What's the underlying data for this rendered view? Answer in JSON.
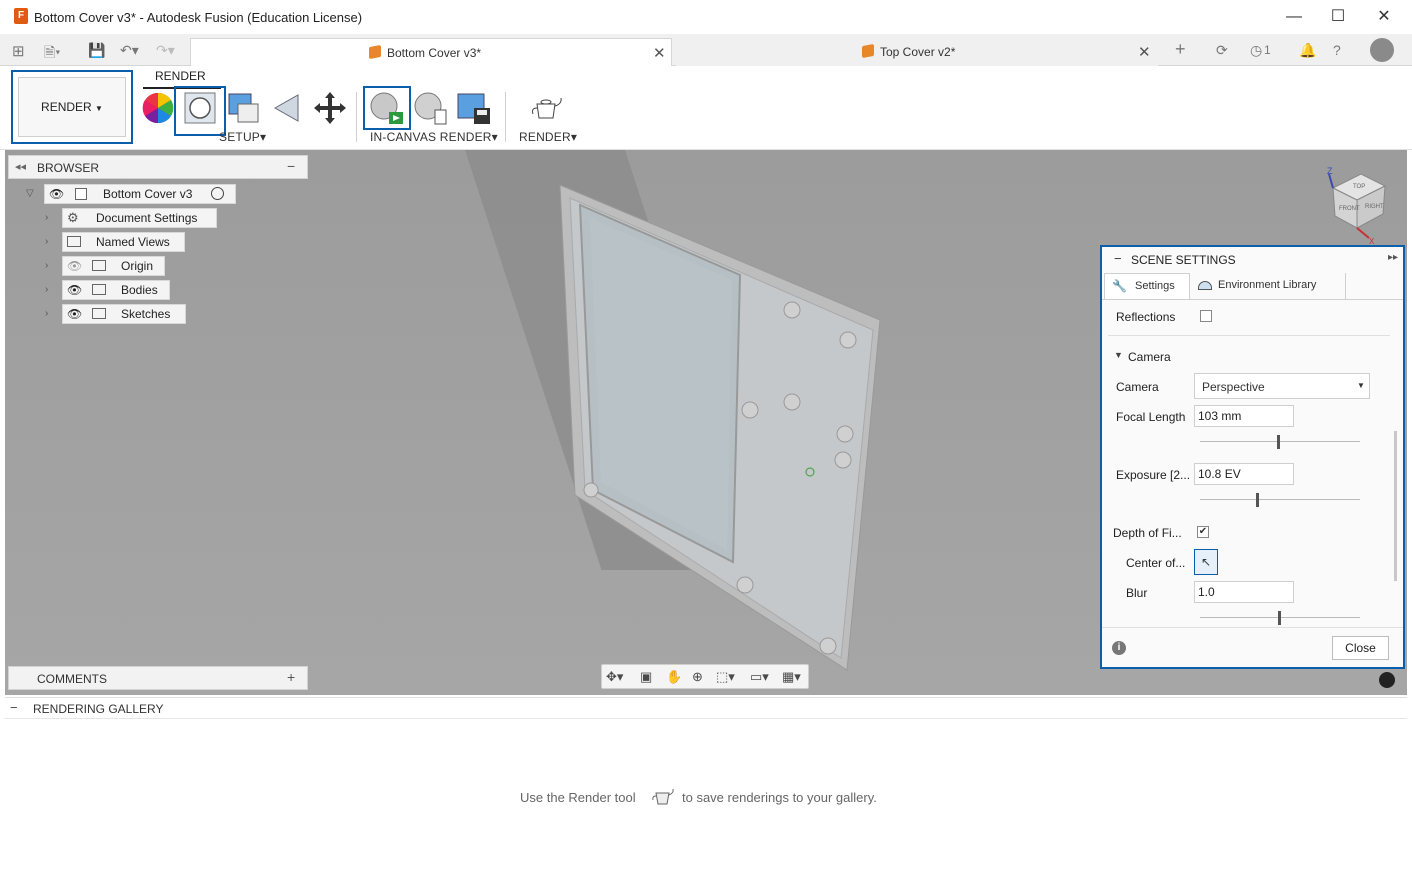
{
  "window": {
    "logo_letter": "F",
    "title": "Bottom Cover v3* - Autodesk Fusion (Education License)",
    "minimize": "—",
    "maximize": "☐",
    "close": "✕"
  },
  "tabs": [
    {
      "label": "Bottom Cover v3*",
      "close": "✕"
    },
    {
      "label": "Top Cover v2*",
      "close": "✕"
    }
  ],
  "tabbar": {
    "add": "+",
    "jobs_count": "1"
  },
  "toolbar": {
    "workspace": "RENDER",
    "workspace_caret": "▼",
    "tab_label": "RENDER",
    "groups": {
      "setup": "SETUP",
      "in_canvas": "IN-CANVAS RENDER",
      "render": "RENDER"
    },
    "caret": "▾"
  },
  "browser": {
    "title": "BROWSER",
    "collapse": "−",
    "root": "Bottom Cover v3",
    "items": [
      {
        "label": "Document Settings",
        "icon": "gear-icon"
      },
      {
        "label": "Named Views",
        "icon": "folder-icon"
      },
      {
        "label": "Origin",
        "icon": "folder-icon"
      },
      {
        "label": "Bodies",
        "icon": "folder-icon"
      },
      {
        "label": "Sketches",
        "icon": "folder-icon"
      }
    ]
  },
  "comments": {
    "title": "COMMENTS",
    "add": "+"
  },
  "scene_settings": {
    "title": "SCENE SETTINGS",
    "tabs": [
      "Settings",
      "Environment Library"
    ],
    "reflections_label": "Reflections",
    "reflections_checked": false,
    "camera_section": "Camera",
    "camera_label": "Camera",
    "camera_value": "Perspective",
    "focal_label": "Focal Length",
    "focal_value": "103 mm",
    "focal_slider": 0.48,
    "exposure_label": "Exposure [2...",
    "exposure_value": "10.8 EV",
    "exposure_slider": 0.35,
    "dof_label": "Depth of Fi...",
    "dof_checked": true,
    "center_label": "Center of...",
    "blur_label": "Blur",
    "blur_value": "1.0",
    "blur_slider": 0.49,
    "close_button": "Close",
    "info": "i"
  },
  "gallery": {
    "title": "RENDERING GALLERY",
    "collapse": "−",
    "message_before": "Use the Render tool",
    "message_after": "to save renderings to your gallery."
  },
  "viewcube": {
    "front": "FRONT",
    "right": "RIGHT",
    "top": "TOP",
    "axis_z": "Z",
    "axis_x": "X"
  },
  "colors": {
    "accent": "#0a5eac",
    "viewport_bg": "#a3a3a3",
    "brand_orange": "#e05a13"
  }
}
